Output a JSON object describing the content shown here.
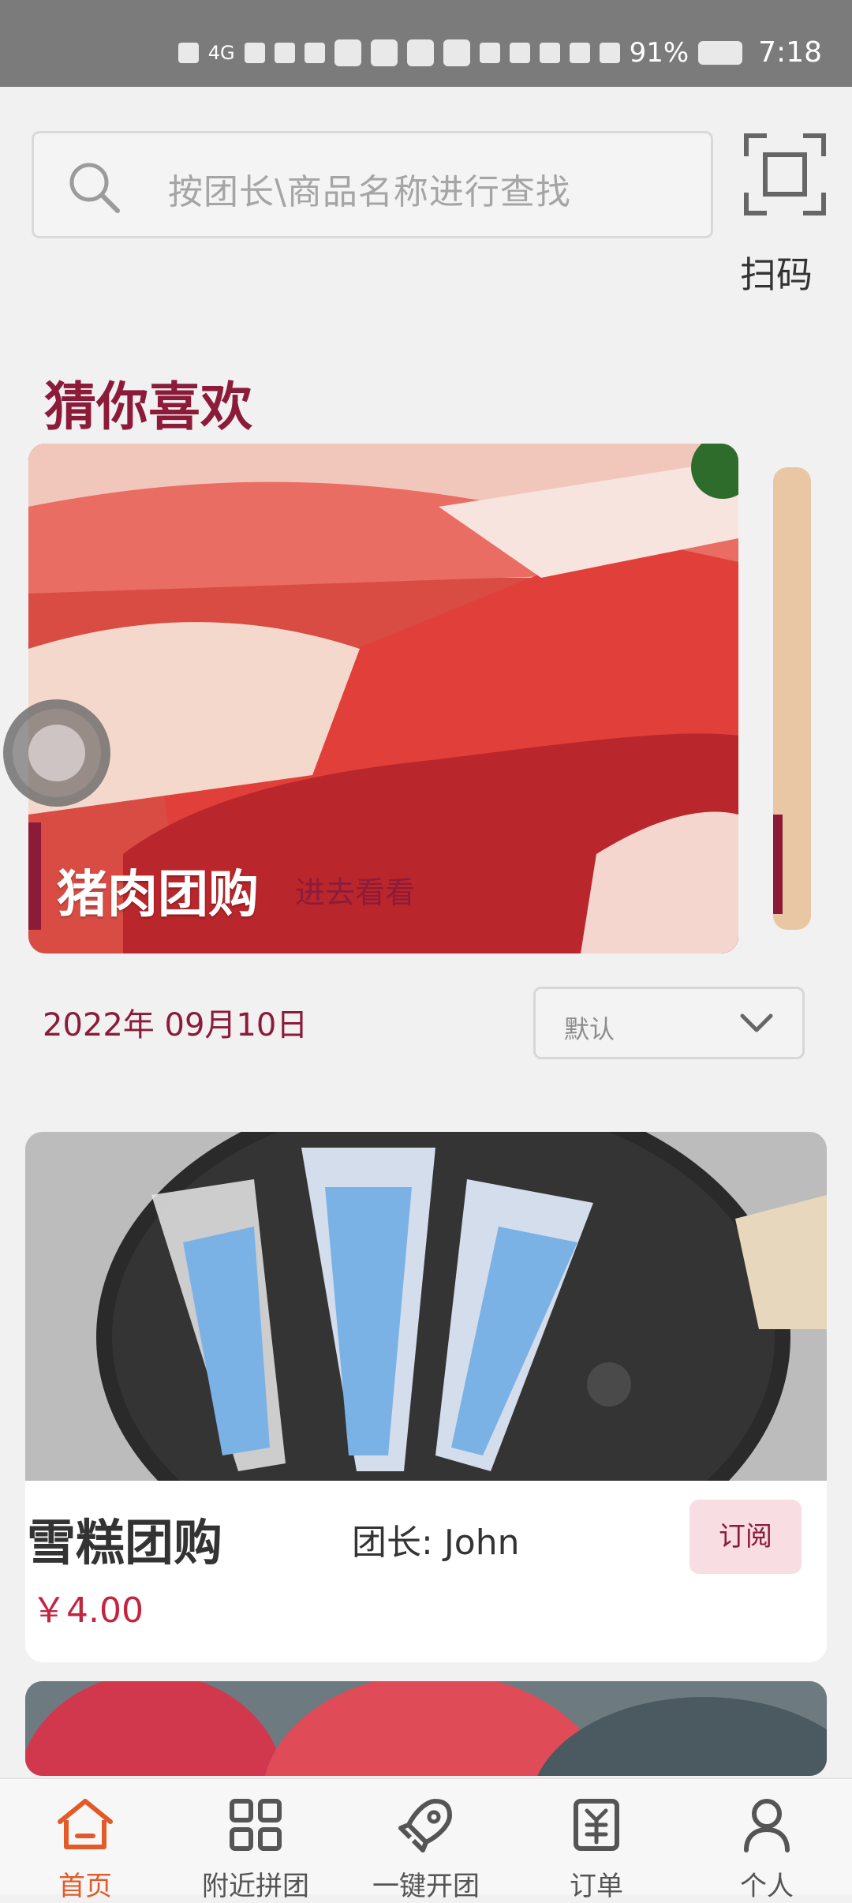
{
  "status_bar": {
    "network": "4G",
    "battery_percent": "91%",
    "time": "7:18"
  },
  "search": {
    "placeholder": "按团长\\商品名称进行查找"
  },
  "scan": {
    "label": "扫码"
  },
  "recommend": {
    "section_title": "猜你喜欢",
    "banner": {
      "title": "猪肉团购",
      "link": "进去看看"
    }
  },
  "filter": {
    "date": "2022年 09月10日",
    "sort_selected": "默认"
  },
  "listing": {
    "items": [
      {
        "title": "雪糕团购",
        "leader_label": "团长:",
        "leader_name": "John",
        "price": "￥4.00",
        "action": "订阅"
      }
    ]
  },
  "tabbar": {
    "items": [
      {
        "label": "首页",
        "icon": "home-icon",
        "active": true
      },
      {
        "label": "附近拼团",
        "icon": "grid-icon",
        "active": false
      },
      {
        "label": "一键开团",
        "icon": "rocket-icon",
        "active": false
      },
      {
        "label": "订单",
        "icon": "order-icon",
        "active": false
      },
      {
        "label": "个人",
        "icon": "person-icon",
        "active": false
      }
    ]
  },
  "colors": {
    "primary": "#8c1b3a",
    "price": "#c0263f",
    "active_tab": "#e35a2a"
  }
}
